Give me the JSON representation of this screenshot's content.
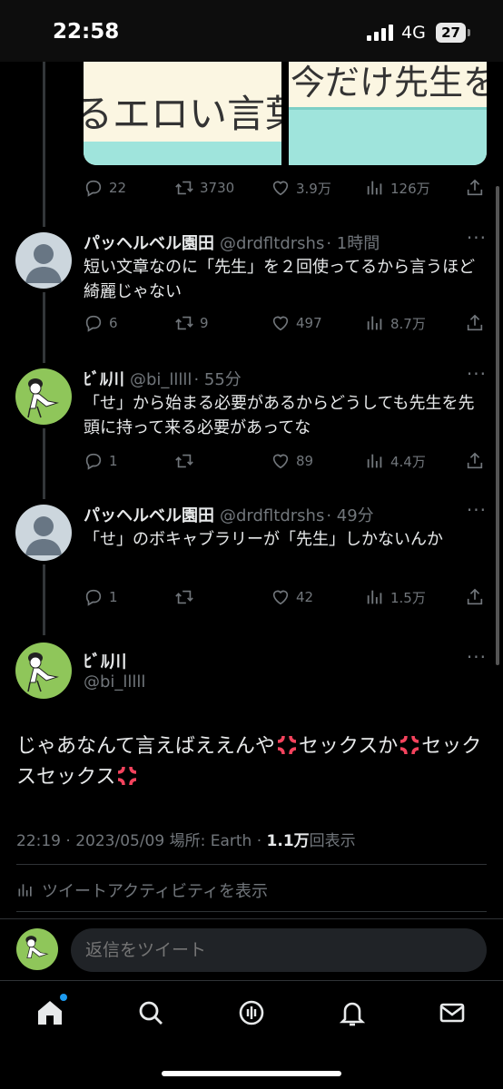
{
  "status_bar": {
    "time": "22:58",
    "network": "4G",
    "battery": "27"
  },
  "media": {
    "left_text": "るエロい言葉",
    "right_text": "今だけ先生を"
  },
  "top_tweet": {
    "actions": {
      "replies": "22",
      "retweets": "3730",
      "likes": "3.9万",
      "views": "126万"
    }
  },
  "replies": [
    {
      "name": "パッヘルベル園田",
      "handle": "@drdfltdrshs",
      "time": "· 1時間",
      "text": "短い文章なのに「先生」を２回使ってるから言うほど綺麗じゃない",
      "replies": "6",
      "retweets": "9",
      "likes": "497",
      "views": "8.7万",
      "avatar": "default"
    },
    {
      "name": "ﾋﾞﾙ川",
      "handle": "@bi_lllll",
      "time": "· 55分",
      "text": "「せ」から始まる必要があるからどうしても先生を先頭に持って来る必要があってな",
      "replies": "1",
      "retweets": "",
      "likes": "89",
      "views": "4.4万",
      "avatar": "frog"
    },
    {
      "name": "パッヘルベル園田",
      "handle": "@drdfltdrshs",
      "time": "· 49分",
      "text": "「せ」のボキャブラリーが「先生」しかないんか",
      "replies": "1",
      "retweets": "",
      "likes": "42",
      "views": "1.5万",
      "avatar": "default"
    }
  ],
  "main_tweet": {
    "name": "ﾋﾞﾙ川",
    "handle": "@bi_lllll",
    "text_1": "じゃあなんて言えばええんや",
    "text_2": "セックスか",
    "text_3": "セックスセックス",
    "timestamp": "22:19 · 2023/05/09 場所: Earth · ",
    "views_count": "1.1万",
    "views_label": "回表示",
    "activity_label": "ツイートアクティビティを表示"
  },
  "reply_bar": {
    "placeholder": "返信をツイート"
  },
  "tabs": [
    "home",
    "search",
    "spaces",
    "notifications",
    "messages"
  ],
  "colors": {
    "background": "#000000",
    "text": "#e7e9ea",
    "secondary": "#71767b",
    "accent": "#1d9bf0",
    "anger": "#f4435d"
  }
}
